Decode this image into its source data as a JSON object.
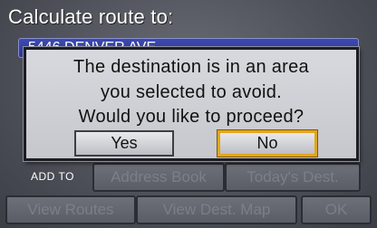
{
  "screen": {
    "title": "Calculate route to:",
    "address": "5446 DENVER AVE"
  },
  "add_to": {
    "label": "ADD TO",
    "address_book": "Address Book",
    "todays_dest": "Today's Dest."
  },
  "bottom": {
    "view_routes": "View Routes",
    "view_dest_map": "View Dest. Map",
    "ok": "OK"
  },
  "dialog": {
    "line1": "The destination is in an area",
    "line2": "you selected to avoid.",
    "line3": "Would you like to proceed?",
    "yes": "Yes",
    "no": "No",
    "selected": "No",
    "focus_color": "#e3a51a"
  }
}
